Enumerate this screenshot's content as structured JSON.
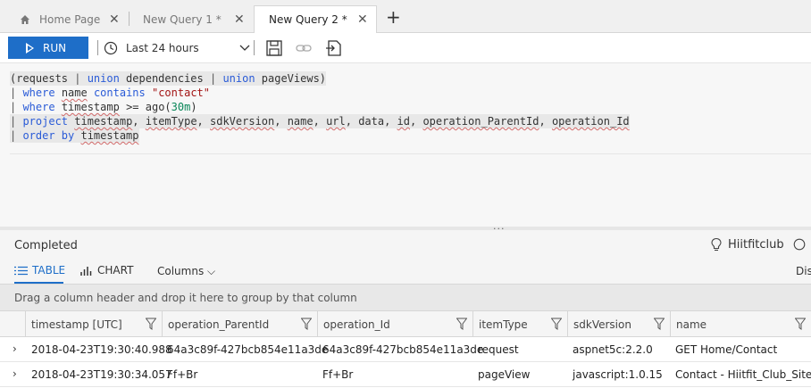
{
  "tabs": [
    {
      "label": "Home Page",
      "close": "✕"
    },
    {
      "label": "New Query 1 *",
      "close": "✕"
    },
    {
      "label": "New Query 2 *",
      "close": "✕",
      "active": true
    }
  ],
  "new_tab": "+",
  "toolbar": {
    "run_label": "RUN",
    "time_range": "Last 24 hours",
    "icons": [
      "clock-icon",
      "chevron-down-icon",
      "save-icon",
      "link-icon",
      "export-icon"
    ]
  },
  "query": {
    "line1": {
      "open": "(requests ",
      "p1": "| ",
      "k1": "union",
      "t1": " dependencies ",
      "p2": "| ",
      "k2": "union",
      "t2": " pageViews)"
    },
    "line2": {
      "p": "| ",
      "k1": "where",
      "s1": " ",
      "u1": "name",
      "s2": " ",
      "k2": "contains",
      "s3": " ",
      "str": "\"contact\""
    },
    "line3": {
      "p": "| ",
      "k1": "where",
      "s1": " ",
      "u1": "timestamp",
      "t1": " >= ago(",
      "num": "30m",
      "t2": ")"
    },
    "line4": {
      "p": "| ",
      "k1": "project",
      "s1": " ",
      "u1": "timestamp",
      "c1": ", ",
      "u2": "itemType",
      "c2": ", ",
      "u3": "sdkVersion",
      "c3": ", ",
      "u4": "name",
      "c4": ", ",
      "u5": "url",
      "c5": ", data, ",
      "u6": "id",
      "c6": ", ",
      "u7": "operation_ParentId",
      "c7": ", ",
      "u8": "operation_Id"
    },
    "line5": {
      "p": "| ",
      "k1": "order by",
      "s1": " ",
      "u1": "timestamp"
    }
  },
  "splitter_grip": "...",
  "results": {
    "status": "Completed",
    "app_name": "Hiitfitclub",
    "tabs": {
      "table": "TABLE",
      "chart": "CHART"
    },
    "columns_label": "Columns",
    "columns_chevron": "⌵",
    "right_cut": "Dis",
    "group_hint": "Drag a column header and drop it here to group by that column",
    "columns": [
      "timestamp [UTC]",
      "operation_ParentId",
      "operation_Id",
      "itemType",
      "sdkVersion",
      "name"
    ],
    "rows": [
      [
        "2018-04-23T19:30:40.988",
        "64a3c89f-427bcb854e11a3de",
        "64a3c89f-427bcb854e11a3de",
        "request",
        "aspnet5c:2.2.0",
        "GET Home/Contact"
      ],
      [
        "2018-04-23T19:30:34.057",
        "Ff+Br",
        "Ff+Br",
        "pageView",
        "javascript:1.0.15",
        "Contact - Hiitfit_Club_Site"
      ]
    ],
    "expander": "›"
  },
  "colors": {
    "accent": "#1e6ec8",
    "keyword": "#2a5bd7",
    "string": "#a31515",
    "number": "#098658"
  }
}
